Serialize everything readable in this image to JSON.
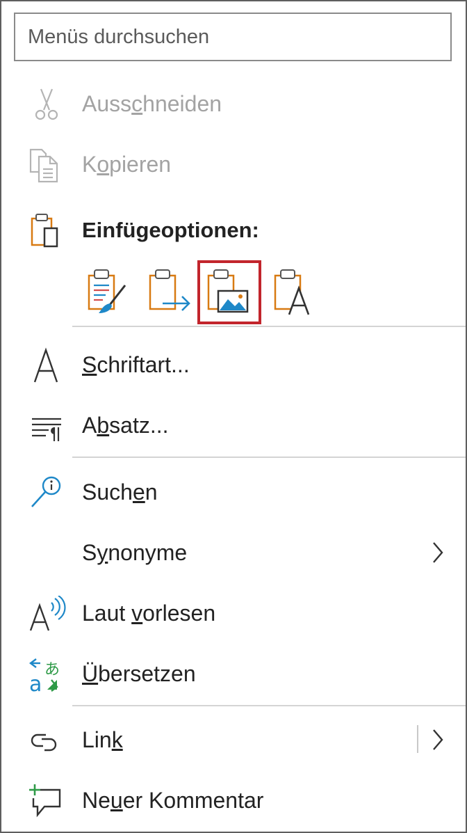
{
  "search": {
    "placeholder": "Menüs durchsuchen"
  },
  "menu": {
    "cut": {
      "pre": "Auss",
      "key": "c",
      "post": "hneiden",
      "icon": "scissors-icon",
      "enabled": false
    },
    "copy": {
      "pre": "K",
      "key": "o",
      "post": "pieren",
      "icon": "copy-icon",
      "enabled": false
    },
    "paste_options": {
      "label": "Einfügeoptionen:",
      "icon": "clipboard-icon"
    },
    "paste_buttons": [
      {
        "icon": "paste-keep-source-formatting-icon",
        "selected": false
      },
      {
        "icon": "paste-merge-formatting-icon",
        "selected": false
      },
      {
        "icon": "paste-picture-icon",
        "selected": true
      },
      {
        "icon": "paste-text-only-icon",
        "selected": false
      }
    ],
    "font": {
      "pre": "",
      "key": "S",
      "post": "chriftart...",
      "icon": "font-icon"
    },
    "paragraph": {
      "pre": "A",
      "key": "b",
      "post": "satz...",
      "icon": "paragraph-icon"
    },
    "search": {
      "pre": "Such",
      "key": "e",
      "post": "n",
      "icon": "smart-lookup-icon"
    },
    "synonyms": {
      "pre": "S",
      "key": "y",
      "post": "nonyme",
      "submenu": true
    },
    "read_aloud": {
      "pre": "Laut ",
      "key": "v",
      "post": "orlesen",
      "icon": "read-aloud-icon"
    },
    "translate": {
      "pre": "",
      "key": "Ü",
      "post": "bersetzen",
      "icon": "translate-icon"
    },
    "link": {
      "pre": "Lin",
      "key": "k",
      "post": "",
      "icon": "link-icon",
      "submenu": true
    },
    "comment": {
      "pre": "Ne",
      "key": "u",
      "post": "er Kommentar",
      "icon": "new-comment-icon"
    }
  },
  "colors": {
    "accent_orange": "#d87a12",
    "accent_blue": "#1e88c8",
    "selected_border": "#c2252c",
    "icon_gray": "#555555",
    "comment_green": "#2e9a47"
  }
}
